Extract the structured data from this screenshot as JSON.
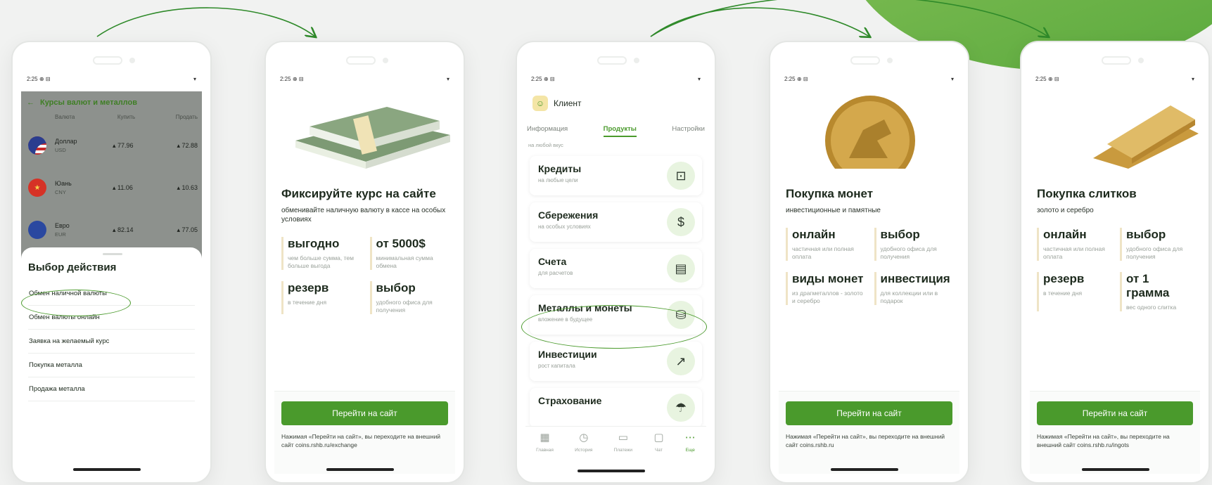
{
  "colors": {
    "accent": "#4a9a2c",
    "blob": "#6cb548",
    "background": "#f1f2f1"
  },
  "status_bar": {
    "time": "2:25",
    "icons": "⊕ ⊟",
    "signal": "▾"
  },
  "phone1": {
    "header_title": "Курсы валют и металлов",
    "columns": [
      "Валюта",
      "Купить",
      "Продать"
    ],
    "rates": [
      {
        "name": "Доллар",
        "code": "USD",
        "buy": "77.96",
        "sell": "72.88",
        "flag": "us"
      },
      {
        "name": "Юань",
        "code": "CNY",
        "buy": "11.06",
        "sell": "10.63",
        "flag": "cn"
      },
      {
        "name": "Евро",
        "code": "EUR",
        "buy": "82.14",
        "sell": "77.05",
        "flag": "eu"
      }
    ],
    "sheet_title": "Выбор действия",
    "actions": [
      "Обмен наличной валюты",
      "Обмен валюты онлайн",
      "Заявка на желаемый курс",
      "Покупка металла",
      "Продажа металла"
    ]
  },
  "phone2": {
    "title": "Фиксируйте курс на сайте",
    "subtitle": "обменивайте наличную валюту в кассе на особых условиях",
    "features": [
      {
        "title": "выгодно",
        "desc": "чем больше сумма, тем больше выгода"
      },
      {
        "title": "от 5000$",
        "desc": "минимальная сумма обмена"
      },
      {
        "title": "резерв",
        "desc": "в течение дня"
      },
      {
        "title": "выбор",
        "desc": "удобного офиса для получения"
      }
    ],
    "cta_label": "Перейти на сайт",
    "cta_note": "Нажимая «Перейти на сайт», вы переходите на внешний сайт coins.rshb.ru/exchange"
  },
  "phone3": {
    "client_label": "Клиент",
    "tabs": [
      "Информация",
      "Продукты",
      "Настройки"
    ],
    "active_tab": "Продукты",
    "partial_top_sub": "на любой вкус",
    "products": [
      {
        "title": "Кредиты",
        "sub": "на любые цели",
        "icon": "credit-icon"
      },
      {
        "title": "Сбережения",
        "sub": "на особых условиях",
        "icon": "savings-bag-icon"
      },
      {
        "title": "Счета",
        "sub": "для расчетов",
        "icon": "account-icon"
      },
      {
        "title": "Металлы и монеты",
        "sub": "вложение в будущее",
        "icon": "metal-bars-icon"
      },
      {
        "title": "Инвестиции",
        "sub": "рост капитала",
        "icon": "chart-icon"
      },
      {
        "title": "Страхование",
        "sub": "",
        "icon": "umbrella-icon"
      }
    ],
    "nav": [
      {
        "label": "Главная",
        "icon": "home-grid-icon"
      },
      {
        "label": "История",
        "icon": "history-icon"
      },
      {
        "label": "Платежи",
        "icon": "card-icon"
      },
      {
        "label": "Чат",
        "icon": "chat-icon"
      },
      {
        "label": "Еще",
        "icon": "more-icon"
      }
    ]
  },
  "phone4": {
    "title": "Покупка монет",
    "subtitle": "инвестиционные и памятные",
    "features": [
      {
        "title": "онлайн",
        "desc": "частичная или полная оплата"
      },
      {
        "title": "выбор",
        "desc": "удобного офиса для получения"
      },
      {
        "title": "виды монет",
        "desc": "из драгметаллов - золото и серебро"
      },
      {
        "title": "инвестиция",
        "desc": "для коллекции или в подарок"
      }
    ],
    "cta_label": "Перейти на сайт",
    "cta_note": "Нажимая «Перейти на сайт», вы переходите на внешний сайт coins.rshb.ru"
  },
  "phone5": {
    "title": "Покупка слитков",
    "subtitle": "золото и серебро",
    "features": [
      {
        "title": "онлайн",
        "desc": "частичная или полная оплата"
      },
      {
        "title": "выбор",
        "desc": "удобного офиса для получения"
      },
      {
        "title": "резерв",
        "desc": "в течение дня"
      },
      {
        "title": "от 1 грамма",
        "desc": "вес одного слитка"
      }
    ],
    "cta_label": "Перейти на сайт",
    "cta_note": "Нажимая «Перейти на сайт», вы переходите на внешний сайт coins.rshb.ru/ingots"
  }
}
